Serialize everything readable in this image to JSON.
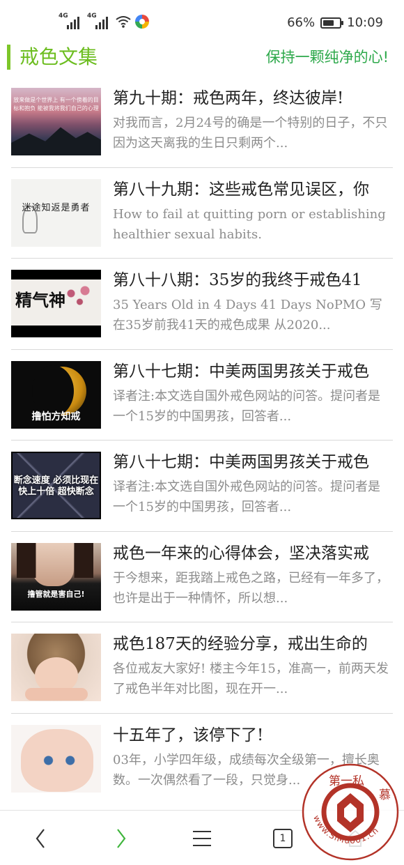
{
  "status_bar": {
    "net1": "4G",
    "net2": "4G",
    "battery_text": "66%",
    "battery_level": 0.66,
    "time": "10:09"
  },
  "header": {
    "title": "戒色文集",
    "slogan": "保持一颗纯净的心!",
    "accent_color": "#6cbd1f"
  },
  "articles": [
    {
      "title": "第九十期：戒色两年，终达彼岸!",
      "desc": "对我而言，2月24号的确是一个特别的日子，不只因为这天离我的生日只剩两个...",
      "thumb_caption": "放来做是个世界上 有一个傍着的目标和抱负 能被我将我们自己的心理"
    },
    {
      "title": "第八十九期：这些戒色常见误区，你",
      "desc": "How to fail at quitting porn or establishing healthier sexual habits.",
      "thumb_caption": "迷途知返是勇者"
    },
    {
      "title": "第八十八期：35岁的我终于戒色41",
      "desc": "35 Years Old in 4 Days 41 Days NoPMO 写在35岁前我41天的戒色成果 从2020...",
      "thumb_caption": "精气神"
    },
    {
      "title": "第八十七期：中美两国男孩关于戒色",
      "desc": "译者注:本文选自国外戒色网站的问答。提问者是一个15岁的中国男孩，回答者...",
      "thumb_caption": "撸怕方知戒"
    },
    {
      "title": "第八十七期：中美两国男孩关于戒色",
      "desc": "译者注:本文选自国外戒色网站的问答。提问者是一个15岁的中国男孩，回答者...",
      "thumb_caption": "断念速度 必须比现在 快上十倍 超快断念"
    },
    {
      "title": "戒色一年来的心得体会，坚决落实戒",
      "desc": "于今想来，距我踏上戒色之路，已经有一年多了，也许是出于一种情怀，所以想...",
      "thumb_caption": "撸管就是害自己!"
    },
    {
      "title": "戒色187天的经验分享，戒出生命的",
      "desc": "各位戒友大家好! 楼主今年15，准高一，前两天发了戒色半年对比图，现在开一...",
      "thumb_caption": ""
    },
    {
      "title": "十五年了，该停下了!",
      "desc": "03年，小学四年级，成绩每次全级第一，擅长奥数。一次偶然看了一段，只觉身...",
      "thumb_caption": ""
    }
  ],
  "bottom_nav": {
    "back_icon": "‹",
    "forward_icon": "›",
    "tab_count": "1"
  },
  "watermark": {
    "top_text": "第一私",
    "side_text": "慕",
    "url_text": "www.SiMuo01.cn"
  }
}
